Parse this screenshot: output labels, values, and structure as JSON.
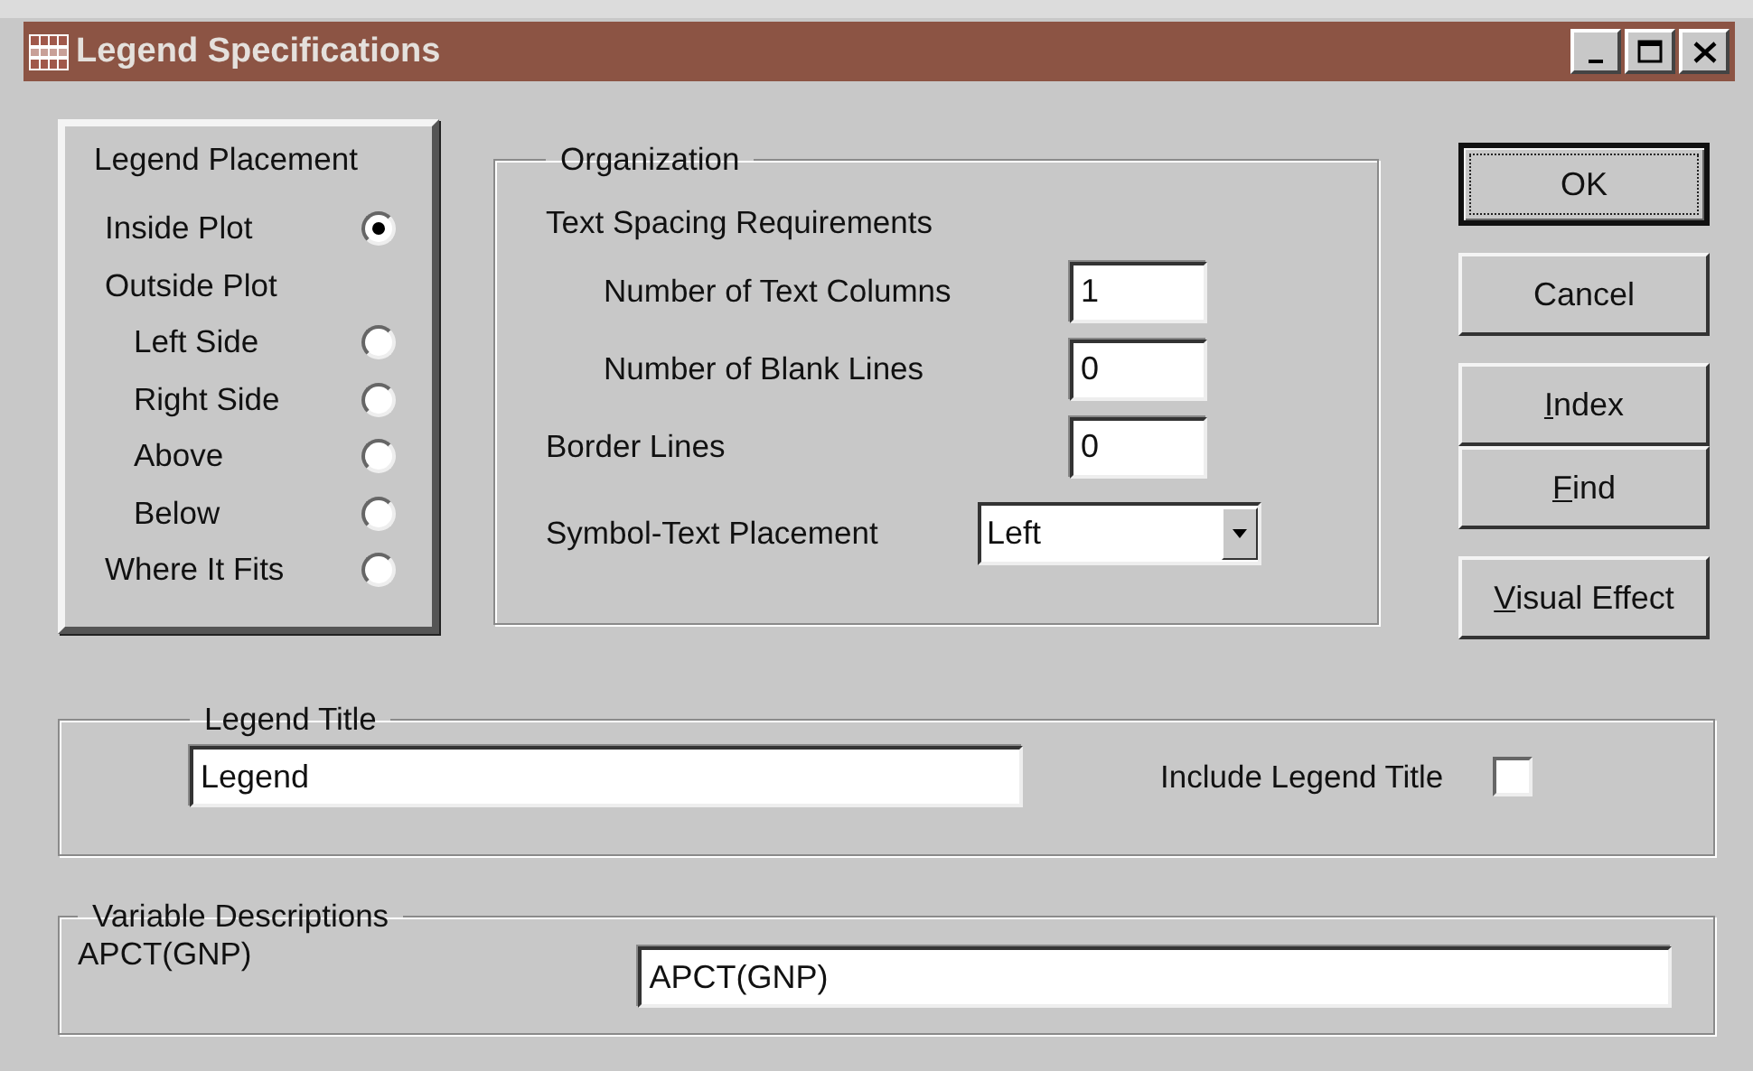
{
  "window": {
    "title": "Legend Specifications"
  },
  "placement": {
    "title": "Legend Placement",
    "options": [
      {
        "label": "Inside Plot",
        "selected": true
      },
      {
        "label": "Outside Plot",
        "children": [
          {
            "label": "Left Side",
            "selected": false
          },
          {
            "label": "Right Side",
            "selected": false
          },
          {
            "label": "Above",
            "selected": false
          },
          {
            "label": "Below",
            "selected": false
          }
        ]
      },
      {
        "label": "Where It Fits",
        "selected": false
      }
    ]
  },
  "organization": {
    "title": "Organization",
    "items": [
      {
        "kind": "group",
        "label": "Text Spacing Requirements",
        "children": [
          {
            "label": "Number of  Text Columns",
            "value": "1"
          },
          {
            "label": "Number of Blank Lines",
            "value": "0"
          }
        ]
      },
      {
        "kind": "field",
        "label": "Border Lines",
        "value": "0"
      },
      {
        "kind": "dropdown",
        "label": "Symbol-Text Placement",
        "value": "Left"
      }
    ]
  },
  "button_groups": [
    {
      "buttons": [
        {
          "label": "OK",
          "default": true,
          "focused": true
        }
      ]
    },
    {
      "buttons": [
        {
          "label": "Cancel",
          "default": false,
          "focused": false
        }
      ]
    },
    {
      "buttons": [
        {
          "accel": "I",
          "rest": "ndex",
          "default": false,
          "focused": false
        },
        {
          "accel": "F",
          "rest": "ind",
          "default": false,
          "focused": false
        }
      ]
    },
    {
      "buttons": [
        {
          "accel": "V",
          "rest": "isual Effect",
          "default": false,
          "focused": false
        }
      ]
    }
  ],
  "legend_title": {
    "title": "Legend Title",
    "value": "Legend",
    "checkbox": {
      "label": "Include Legend Title",
      "checked": false
    }
  },
  "variable_descriptions": {
    "title": "Variable Descriptions",
    "rows": [
      {
        "name": "APCT(GNP)",
        "value": "APCT(GNP)"
      }
    ]
  }
}
